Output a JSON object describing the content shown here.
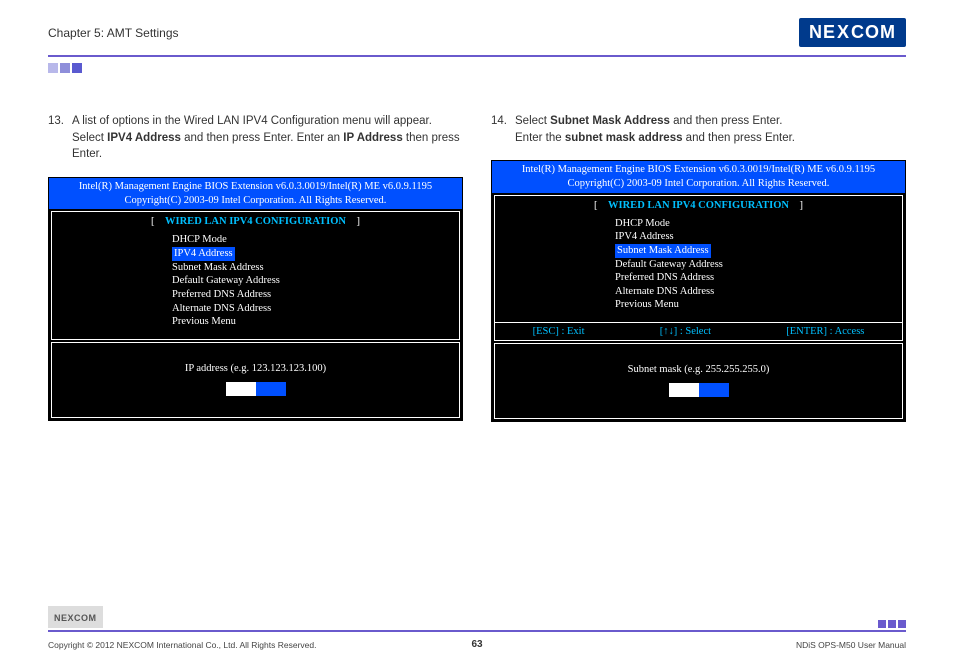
{
  "header": {
    "chapter": "Chapter 5: AMT Settings",
    "logo_text": "NEXCOM"
  },
  "left": {
    "num": "13.",
    "text_pre": "A list of options in the Wired LAN IPV4 Configuration menu will appear. Select ",
    "bold1": "IPV4 Address",
    "text_mid": " and then press Enter. Enter an ",
    "bold2": "IP Address",
    "text_post": " then press Enter.",
    "bios": {
      "header_l1": "Intel(R) Management Engine BIOS Extension v6.0.3.0019/Intel(R) ME v6.0.9.1195",
      "header_l2": "Copyright(C) 2003-09 Intel Corporation. All Rights Reserved.",
      "section": "WIRED LAN IPV4 CONFIGURATION",
      "menu": [
        "DHCP Mode",
        "IPV4 Address",
        "Subnet Mask Address",
        "Default Gateway Address",
        "Preferred DNS Address",
        "Alternate DNS Address",
        "Previous Menu"
      ],
      "selected_index": 1,
      "prompt": "IP address (e.g. 123.123.123.100)"
    }
  },
  "right": {
    "num": "14.",
    "text_pre": "Select ",
    "bold1": "Subnet Mask Address",
    "text_mid": " and then press Enter.\nEnter the ",
    "bold2": "subnet mask address",
    "text_post": " and then press Enter.",
    "bios": {
      "header_l1": "Intel(R) Management Engine BIOS Extension v6.0.3.0019/Intel(R) ME v6.0.9.1195",
      "header_l2": "Copyright(C) 2003-09 Intel Corporation. All Rights Reserved.",
      "section": "WIRED LAN IPV4 CONFIGURATION",
      "menu": [
        "DHCP Mode",
        "IPV4 Address",
        "Subnet Mask Address",
        "Default Gateway Address",
        "Preferred DNS Address",
        "Alternate DNS Address",
        "Previous Menu"
      ],
      "selected_index": 2,
      "nav": {
        "esc": "[ESC] : Exit",
        "arrows": "[↑↓] : Select",
        "enter": "[ENTER] : Access"
      },
      "prompt": "Subnet mask (e.g. 255.255.255.0)"
    }
  },
  "footer": {
    "logo": "NEXCOM",
    "copyright": "Copyright © 2012 NEXCOM International Co., Ltd. All Rights Reserved.",
    "page": "63",
    "manual": "NDiS OPS-M50 User Manual"
  }
}
